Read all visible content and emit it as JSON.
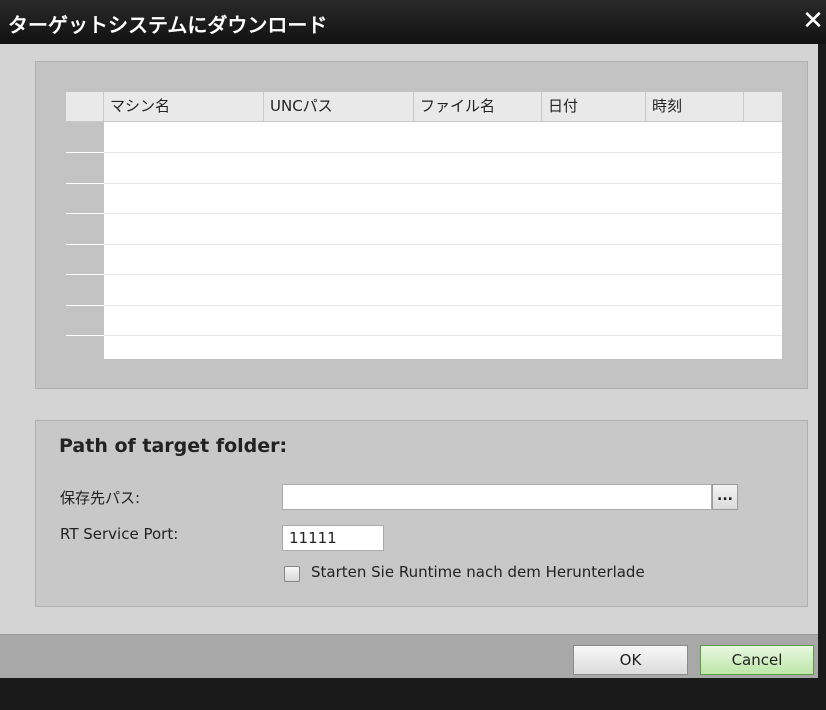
{
  "window": {
    "title": "ターゲットシステムにダウンロード",
    "close_glyph": "✕"
  },
  "table": {
    "columns": [
      "マシン名",
      "UNCパス",
      "ファイル名",
      "日付",
      "時刻",
      ""
    ],
    "rows": []
  },
  "target": {
    "section_title": "Path of target folder:",
    "path_label": "保存先パス:",
    "path_value": "",
    "browse_label": "...",
    "port_label": "RT Service Port:",
    "port_value": "11111",
    "start_runtime_label": "Starten Sie Runtime nach dem Herunterlade",
    "start_runtime_checked": false
  },
  "buttons": {
    "ok": "OK",
    "cancel": "Cancel"
  },
  "colors": {
    "cancel_accent": "#bde6a8",
    "dialog_bg": "#d4d4d4"
  }
}
